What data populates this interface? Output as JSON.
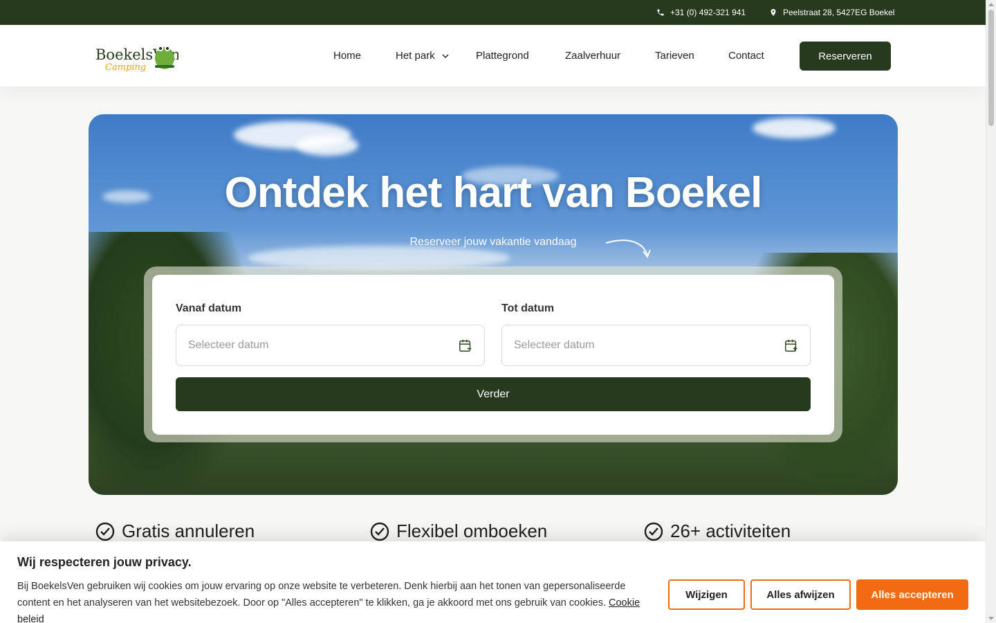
{
  "topbar": {
    "phone": "+31 (0) 492-321 941",
    "address": "Peelstraat 28, 5427EG Boekel"
  },
  "header": {
    "logo_text": "BoekelsVen",
    "logo_sub": "Camping",
    "nav": [
      "Home",
      "Het park",
      "Plattegrond",
      "Zaalverhuur",
      "Tarieven",
      "Contact"
    ],
    "reserve_label": "Reserveren"
  },
  "hero": {
    "title": "Ontdek het hart van Boekel",
    "subtitle": "Reserveer jouw vakantie vandaag",
    "from_label": "Vanaf datum",
    "to_label": "Tot datum",
    "date_placeholder": "Selecteer datum",
    "continue_label": "Verder"
  },
  "features": [
    "Gratis annuleren",
    "Flexibel omboeken",
    "26+ activiteiten"
  ],
  "cookie": {
    "title": "Wij respecteren jouw privacy.",
    "text": "Bij BoekelsVen gebruiken wij cookies om jouw ervaring op onze website te verbeteren. Denk hierbij aan het tonen van gepersonaliseerde content en het analyseren van het websitebezoek. Door op \"Alles accepteren\" te klikken, ga je akkoord met ons gebruik van cookies.",
    "link": "Cookie beleid",
    "btn_change": "Wijzigen",
    "btn_reject": "Alles afwijzen",
    "btn_accept": "Alles accepteren"
  },
  "colors": {
    "brand_dark": "#283a1e",
    "accent_orange": "#f26b11"
  },
  "icons": {
    "phone": "phone-icon",
    "location": "location-pin-icon",
    "dropdown": "chevron-down-icon",
    "calendar_from": "calendar-minus-icon",
    "calendar_to": "calendar-plus-icon",
    "check": "check-circle-icon",
    "arrow": "curved-arrow-icon"
  }
}
